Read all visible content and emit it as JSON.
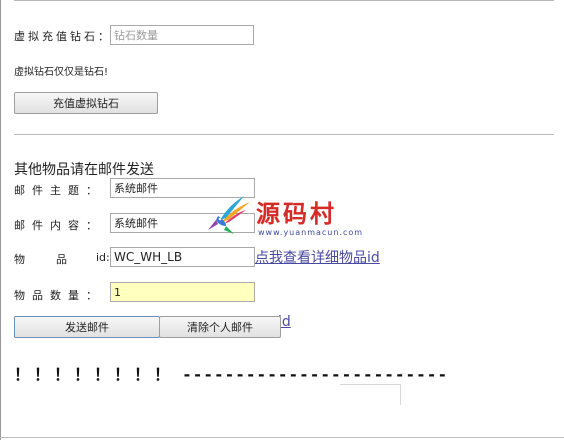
{
  "recharge": {
    "label": "虚拟充值钻石：",
    "input_placeholder": "钻石数量",
    "note": "虚拟钻石仅仅是钻石!",
    "button": "充值虚拟钻石"
  },
  "mail": {
    "section_title": "其他物品请在邮件发送",
    "subject_label": "邮件主题：",
    "subject_value": "系统邮件",
    "content_label": "邮件内容：",
    "content_value": "系统邮件",
    "item_label_a": "物",
    "item_label_b": "品",
    "item_label_id": "id:",
    "item_value": "WC_WH_LB",
    "item_link": "点我查看详细物品id",
    "qty_label": "物品数量：",
    "qty_value": "1",
    "send_button": "发送邮件",
    "clear_button": "清除个人邮件",
    "link_fragment": "id"
  },
  "footer": {
    "text": "！！！！！！！！ -------------------------"
  },
  "watermark": {
    "text": "源码村",
    "url": "www.yuanmacun.com"
  },
  "colors": {
    "link": "#4a4aa0",
    "qty_bg": "#ffffc0",
    "watermark_red": "#d42b27",
    "watermark_blue": "#3b4a9b"
  }
}
